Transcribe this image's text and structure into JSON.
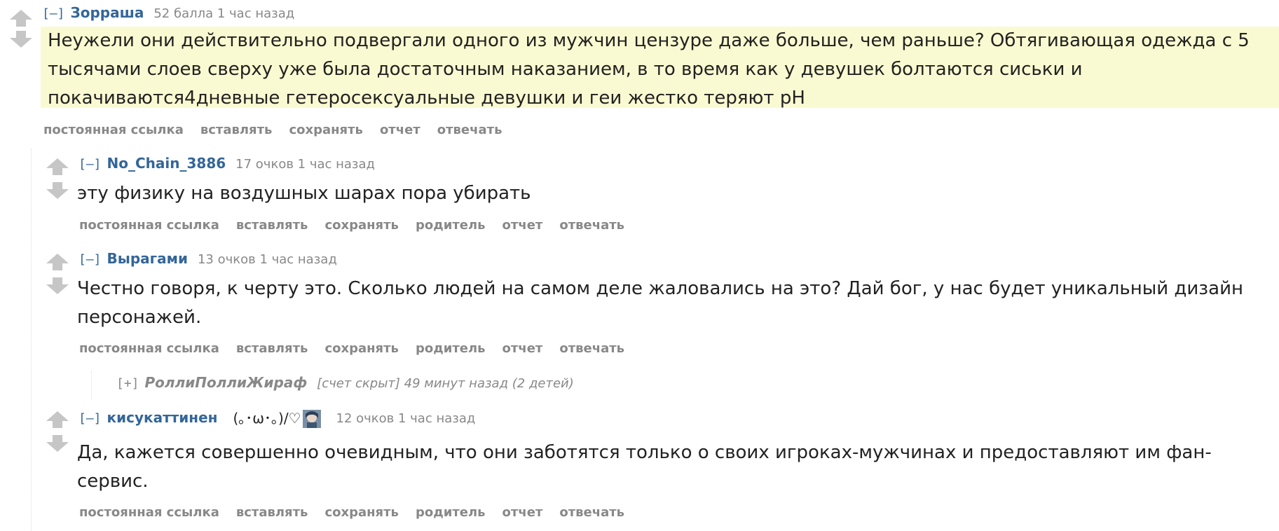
{
  "comments": [
    {
      "toggle": "[–]",
      "author": "Зорраша",
      "meta": "52 балла 1 час назад",
      "text": "Неужели они действительно подвергали одного из мужчин цензуре даже больше, чем раньше? Обтягивающая одежда с 5 тысячами слоев сверху уже была достаточным наказанием, в то время как у девушек болтаются сиськи и покачиваются4дневные гетеросексуальные девушки и геи жестко теряют pH",
      "buttons": [
        "постоянная ссылка",
        "вставлять",
        "сохранять",
        "отчет",
        "отвечать"
      ]
    },
    {
      "toggle": "[–]",
      "author": "No_Chain_3886",
      "meta": "17 очков 1 час назад",
      "text": "эту физику на воздушных шарах пора убирать",
      "buttons": [
        "постоянная ссылка",
        "вставлять",
        "сохранять",
        "родитель",
        "отчет",
        "отвечать"
      ]
    },
    {
      "toggle": "[–]",
      "author": "Вырагами",
      "meta": "13 очков 1 час назад",
      "text": "Честно говоря, к черту это. Сколько людей на самом деле жаловались на это? Дай бог, у нас будет уникальный дизайн персонажей.",
      "buttons": [
        "постоянная ссылка",
        "вставлять",
        "сохранять",
        "родитель",
        "отчет",
        "отвечать"
      ]
    },
    {
      "toggle": "[–]",
      "author": "кисукаттинен",
      "flair": "(｡･ω･｡)/♡",
      "meta": "12 очков 1 час назад",
      "text": "Да, кажется совершенно очевидным, что они заботятся только о своих игроках-мужчинах и предоставляют им фан-сервис.",
      "buttons": [
        "постоянная ссылка",
        "вставлять",
        "сохранять",
        "родитель",
        "отчет",
        "отвечать"
      ]
    }
  ],
  "collapsed": {
    "toggle": "[+]",
    "author": "РоллиПоллиЖираф",
    "meta": "[счет скрыт] 49 минут назад (2 детей)"
  },
  "colors": {
    "link": "#336699",
    "meta": "#888888",
    "highlight": "#fafad2",
    "arrow": "#c6c6c6"
  },
  "icons": {
    "upvote": "upvote-arrow-icon",
    "downvote": "downvote-arrow-icon"
  }
}
